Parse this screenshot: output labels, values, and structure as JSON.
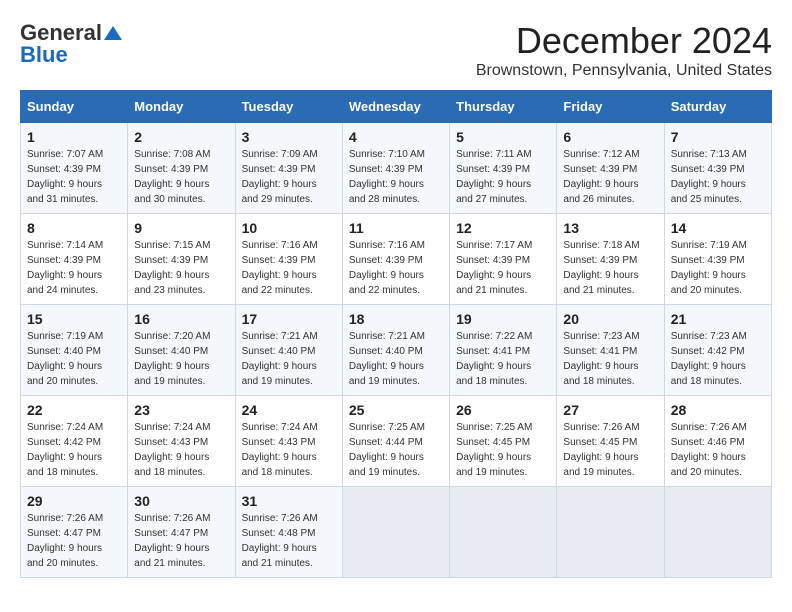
{
  "header": {
    "logo_general": "General",
    "logo_blue": "Blue",
    "month_title": "December 2024",
    "location": "Brownstown, Pennsylvania, United States"
  },
  "calendar": {
    "days_of_week": [
      "Sunday",
      "Monday",
      "Tuesday",
      "Wednesday",
      "Thursday",
      "Friday",
      "Saturday"
    ],
    "weeks": [
      [
        {
          "day": "1",
          "sunrise": "7:07 AM",
          "sunset": "4:39 PM",
          "daylight": "9 hours and 31 minutes."
        },
        {
          "day": "2",
          "sunrise": "7:08 AM",
          "sunset": "4:39 PM",
          "daylight": "9 hours and 30 minutes."
        },
        {
          "day": "3",
          "sunrise": "7:09 AM",
          "sunset": "4:39 PM",
          "daylight": "9 hours and 29 minutes."
        },
        {
          "day": "4",
          "sunrise": "7:10 AM",
          "sunset": "4:39 PM",
          "daylight": "9 hours and 28 minutes."
        },
        {
          "day": "5",
          "sunrise": "7:11 AM",
          "sunset": "4:39 PM",
          "daylight": "9 hours and 27 minutes."
        },
        {
          "day": "6",
          "sunrise": "7:12 AM",
          "sunset": "4:39 PM",
          "daylight": "9 hours and 26 minutes."
        },
        {
          "day": "7",
          "sunrise": "7:13 AM",
          "sunset": "4:39 PM",
          "daylight": "9 hours and 25 minutes."
        }
      ],
      [
        {
          "day": "8",
          "sunrise": "7:14 AM",
          "sunset": "4:39 PM",
          "daylight": "9 hours and 24 minutes."
        },
        {
          "day": "9",
          "sunrise": "7:15 AM",
          "sunset": "4:39 PM",
          "daylight": "9 hours and 23 minutes."
        },
        {
          "day": "10",
          "sunrise": "7:16 AM",
          "sunset": "4:39 PM",
          "daylight": "9 hours and 22 minutes."
        },
        {
          "day": "11",
          "sunrise": "7:16 AM",
          "sunset": "4:39 PM",
          "daylight": "9 hours and 22 minutes."
        },
        {
          "day": "12",
          "sunrise": "7:17 AM",
          "sunset": "4:39 PM",
          "daylight": "9 hours and 21 minutes."
        },
        {
          "day": "13",
          "sunrise": "7:18 AM",
          "sunset": "4:39 PM",
          "daylight": "9 hours and 21 minutes."
        },
        {
          "day": "14",
          "sunrise": "7:19 AM",
          "sunset": "4:39 PM",
          "daylight": "9 hours and 20 minutes."
        }
      ],
      [
        {
          "day": "15",
          "sunrise": "7:19 AM",
          "sunset": "4:40 PM",
          "daylight": "9 hours and 20 minutes."
        },
        {
          "day": "16",
          "sunrise": "7:20 AM",
          "sunset": "4:40 PM",
          "daylight": "9 hours and 19 minutes."
        },
        {
          "day": "17",
          "sunrise": "7:21 AM",
          "sunset": "4:40 PM",
          "daylight": "9 hours and 19 minutes."
        },
        {
          "day": "18",
          "sunrise": "7:21 AM",
          "sunset": "4:40 PM",
          "daylight": "9 hours and 19 minutes."
        },
        {
          "day": "19",
          "sunrise": "7:22 AM",
          "sunset": "4:41 PM",
          "daylight": "9 hours and 18 minutes."
        },
        {
          "day": "20",
          "sunrise": "7:23 AM",
          "sunset": "4:41 PM",
          "daylight": "9 hours and 18 minutes."
        },
        {
          "day": "21",
          "sunrise": "7:23 AM",
          "sunset": "4:42 PM",
          "daylight": "9 hours and 18 minutes."
        }
      ],
      [
        {
          "day": "22",
          "sunrise": "7:24 AM",
          "sunset": "4:42 PM",
          "daylight": "9 hours and 18 minutes."
        },
        {
          "day": "23",
          "sunrise": "7:24 AM",
          "sunset": "4:43 PM",
          "daylight": "9 hours and 18 minutes."
        },
        {
          "day": "24",
          "sunrise": "7:24 AM",
          "sunset": "4:43 PM",
          "daylight": "9 hours and 18 minutes."
        },
        {
          "day": "25",
          "sunrise": "7:25 AM",
          "sunset": "4:44 PM",
          "daylight": "9 hours and 19 minutes."
        },
        {
          "day": "26",
          "sunrise": "7:25 AM",
          "sunset": "4:45 PM",
          "daylight": "9 hours and 19 minutes."
        },
        {
          "day": "27",
          "sunrise": "7:26 AM",
          "sunset": "4:45 PM",
          "daylight": "9 hours and 19 minutes."
        },
        {
          "day": "28",
          "sunrise": "7:26 AM",
          "sunset": "4:46 PM",
          "daylight": "9 hours and 20 minutes."
        }
      ],
      [
        {
          "day": "29",
          "sunrise": "7:26 AM",
          "sunset": "4:47 PM",
          "daylight": "9 hours and 20 minutes."
        },
        {
          "day": "30",
          "sunrise": "7:26 AM",
          "sunset": "4:47 PM",
          "daylight": "9 hours and 21 minutes."
        },
        {
          "day": "31",
          "sunrise": "7:26 AM",
          "sunset": "4:48 PM",
          "daylight": "9 hours and 21 minutes."
        },
        null,
        null,
        null,
        null
      ]
    ]
  }
}
